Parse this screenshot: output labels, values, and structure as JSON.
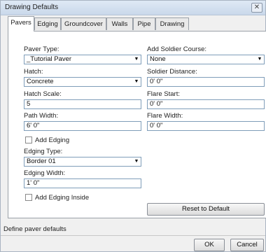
{
  "window": {
    "title": "Drawing Defaults",
    "close_glyph": "✕"
  },
  "tabs": [
    {
      "label": "Pavers",
      "active": true
    },
    {
      "label": "Edging",
      "active": false
    },
    {
      "label": "Groundcover",
      "active": false
    },
    {
      "label": "Walls",
      "active": false
    },
    {
      "label": "Pipe",
      "active": false
    },
    {
      "label": "Drawing",
      "active": false
    }
  ],
  "left": {
    "paver_type": {
      "label": "Paver Type:",
      "value": "_Tutorial Paver"
    },
    "hatch": {
      "label": "Hatch:",
      "value": "Concrete"
    },
    "hatch_scale": {
      "label": "Hatch Scale:",
      "value": "5"
    },
    "path_width": {
      "label": "Path Width:",
      "value": "6' 0\""
    },
    "add_edging": {
      "label": "Add Edging",
      "checked": false
    },
    "edging_type": {
      "label": "Edging Type:",
      "value": "Border 01"
    },
    "edging_width": {
      "label": "Edging Width:",
      "value": "1' 0\""
    },
    "add_edging_inside": {
      "label": "Add Edging Inside",
      "checked": false
    }
  },
  "right": {
    "soldier_course": {
      "label": "Add Soldier Course:",
      "value": "None"
    },
    "soldier_distance": {
      "label": "Soldier Distance:",
      "value": "0' 0\""
    },
    "flare_start": {
      "label": "Flare Start:",
      "value": "0' 0\""
    },
    "flare_width": {
      "label": "Flare Width:",
      "value": "0' 0\""
    }
  },
  "reset_label": "Reset to Default",
  "status_text": "Define paver defaults",
  "ok_label": "OK",
  "cancel_label": "Cancel",
  "dropdown_glyph": "▼"
}
